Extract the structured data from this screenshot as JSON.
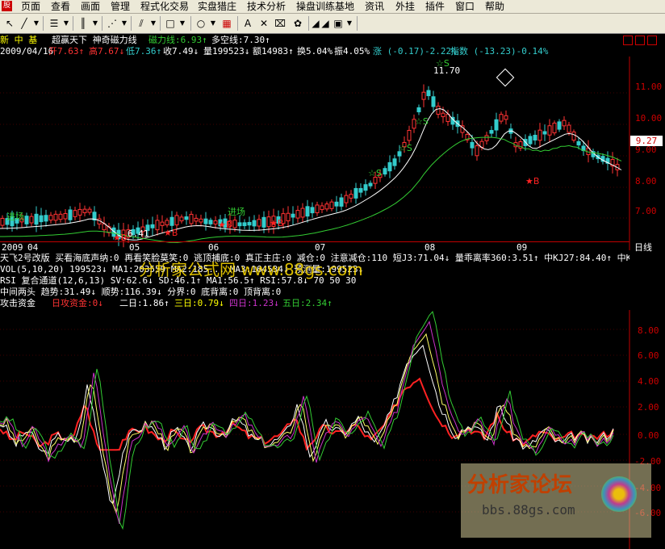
{
  "menu": {
    "items": [
      "页面",
      "查看",
      "画面",
      "管理",
      "程式化交易",
      "实盘猎庄",
      "技术分析",
      "操盘训练基地",
      "资讯",
      "外挂",
      "插件",
      "窗口",
      "帮助"
    ]
  },
  "stock": {
    "name": "新 中 基",
    "indicator_title": "超赢天下 神奇磁力线",
    "magnet_line": "磁力线:6.93↑",
    "bull_bear_line": "多空线:7.30↑",
    "date": "2009/04/16",
    "open": "开7.63↑",
    "high": "高7.67↓",
    "low": "低7.36↑",
    "close": "收7.49↓",
    "volume": "量199523↓",
    "amount": "额14983↑",
    "turnover": "换5.04%",
    "amplitude": "振4.05%",
    "change": "涨 (-0.17)-2.22%",
    "index_change": "指数 (-13.23)-0.14%"
  },
  "price_chart": {
    "price_labels": [
      "11.00",
      "10.00",
      "9.00",
      "8.00",
      "7.00"
    ],
    "current_price": "9.27",
    "peak_label": "11.70",
    "low_label": "6.41",
    "month_labels": [
      "2009",
      "04",
      "05",
      "06",
      "07",
      "08",
      "09"
    ],
    "period_label": "日线",
    "annotations": {
      "entry1": "进场",
      "entry2": "进场",
      "buy": "B",
      "sell": "S"
    }
  },
  "panels": {
    "line1": "天飞2号改版 买看海底声纳:0 再看笑脸莫笑:0 逃顶捕底:0 真正主庄:0 减仓:0 注意减仓:110 短J3:71.04↓ 量乖离率360:3.51↑ 中KJ27:84.40↑ 中K",
    "line2": "VOL(5,10,20) 199523↓ MA1:203559 MA2:185... MA3:164534↓ 预测量:199523↓",
    "line3": "RSI 复合通道(12,6,13)                SV:62.6↓ SD:46.1↑ MA1:56.5↑   RSI:57.8↓ 70 50 30",
    "line4": "中间两头 趋势:31.49↓ 顺势:116.39↓ 分界:0 底背离:0 顶背离:0",
    "line5_label": "攻击资金",
    "line5_items": [
      "日攻资金:0↓",
      "二日:1.86↑",
      "三日:0.79↓",
      "四日:1.23↓",
      "五日:2.34↑"
    ]
  },
  "osc_chart": {
    "labels": [
      "8.00",
      "6.00",
      "4.00",
      "2.00",
      "0.00",
      "-2.00",
      "-4.00",
      "-6.00"
    ]
  },
  "watermark": {
    "main": "分析家公式网 www.88gs.com",
    "forum": "分析家论坛",
    "forum_url": "bbs.88gs.com"
  },
  "colors": {
    "up": "#ff3333",
    "down": "#33cccc",
    "ma_white": "#ffffff",
    "ma_green": "#33cc33",
    "axis": "#c00000"
  }
}
